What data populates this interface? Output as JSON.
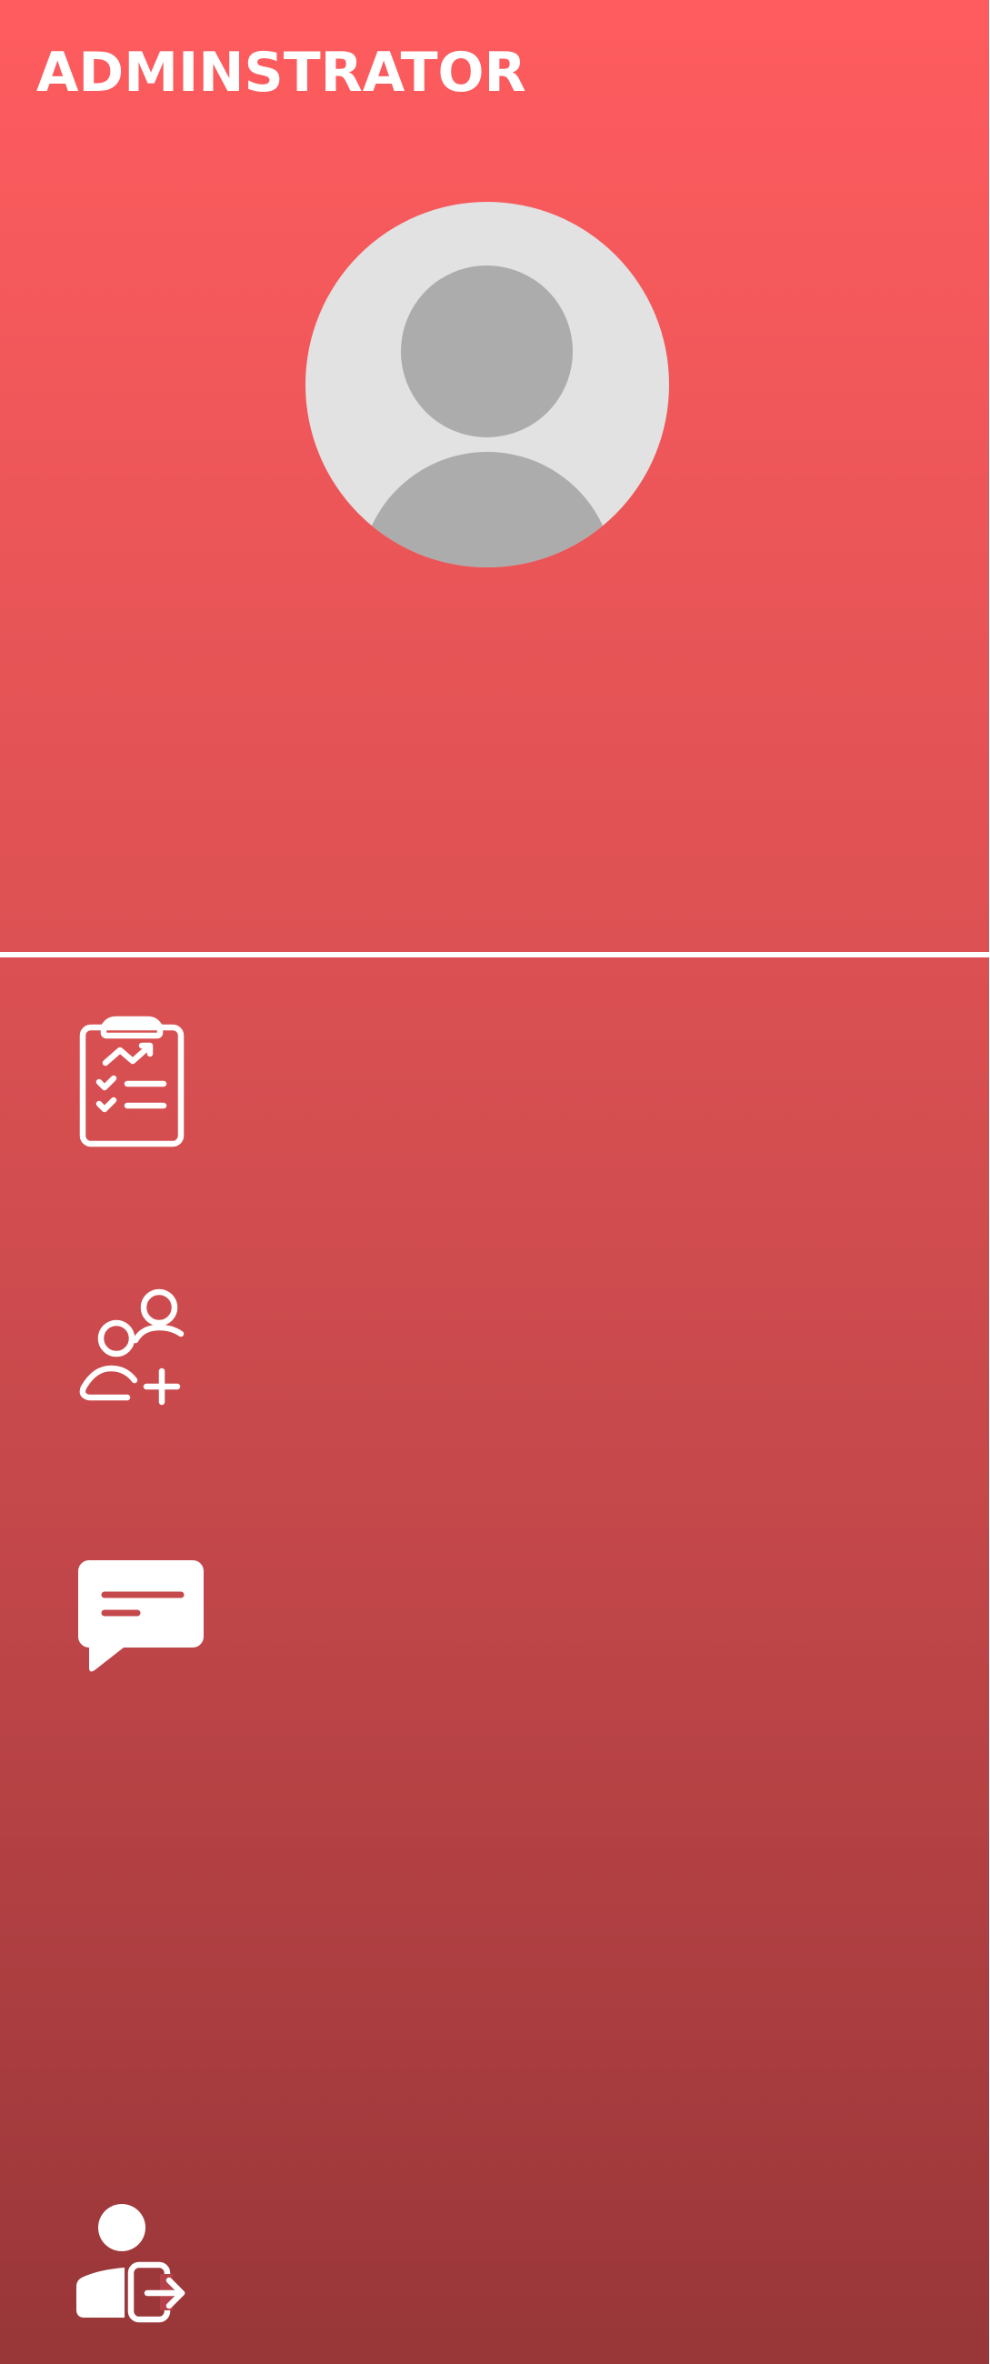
{
  "sidebar": {
    "title": "ADMINSTRATOR",
    "profile": {
      "avatar_icon": "default-user-avatar"
    },
    "nav_items": [
      {
        "id": "reports",
        "icon": "clipboard-checklist-chart-icon"
      },
      {
        "id": "add-user",
        "icon": "users-plus-icon"
      },
      {
        "id": "messages",
        "icon": "message-bubble-icon"
      }
    ],
    "footer": {
      "logout_icon": "user-logout-icon"
    },
    "colors": {
      "gradient_top": "#ff5c5f",
      "gradient_bottom": "#983638",
      "foreground": "#ffffff",
      "avatar_bg": "#e2e2e2",
      "avatar_fg": "#acacac"
    }
  }
}
